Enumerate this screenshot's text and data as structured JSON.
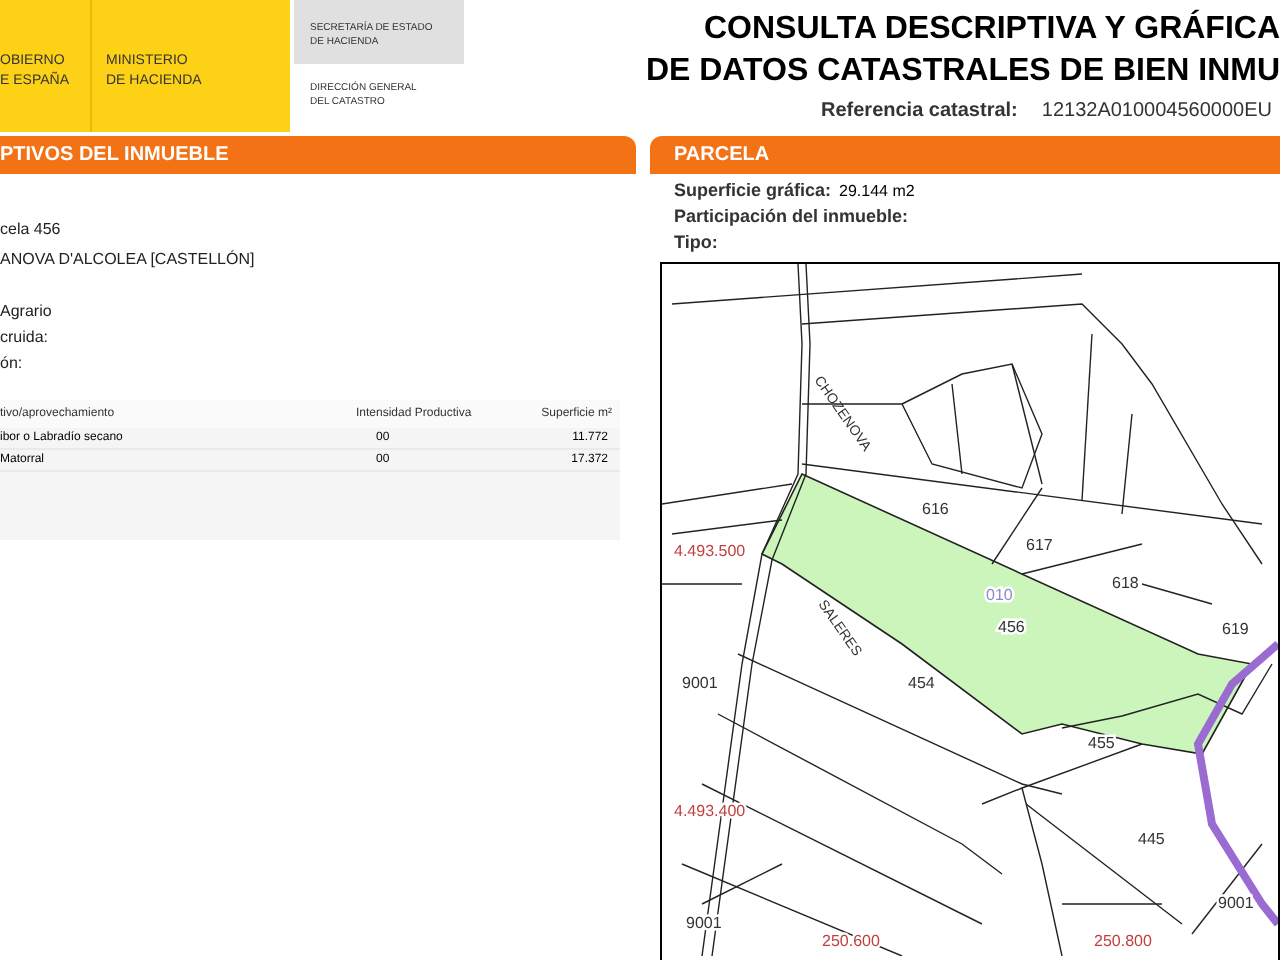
{
  "header": {
    "logo_left": [
      "OBIERNO",
      "E ESPAÑA"
    ],
    "logo_right": [
      "MINISTERIO",
      "DE HACIENDA"
    ],
    "secretaria": [
      "SECRETARÍA DE ESTADO",
      "DE HACIENDA"
    ],
    "direccion": [
      "DIRECCIÓN GENERAL",
      "DEL CATASTRO"
    ],
    "title": [
      "CONSULTA DESCRIPTIVA Y GRÁFICA",
      "DE DATOS CATASTRALES DE BIEN INMU"
    ],
    "reference_label": "Referencia catastral:",
    "reference_value": "12132A010004560000EU"
  },
  "left_panel": {
    "title": "PTIVOS DEL INMUEBLE",
    "lines": [
      "cela 456",
      "ANOVA D'ALCOLEA [CASTELLÓN]"
    ],
    "fields": [
      "Agrario",
      "cruida:",
      "ón:"
    ],
    "table": {
      "columns": [
        "tivo/aprovechamiento",
        "Intensidad Productiva",
        "Superficie m²"
      ],
      "rows": [
        [
          "ibor o Labradío secano",
          "00",
          "11.772"
        ],
        [
          "Matorral",
          "00",
          "17.372"
        ]
      ]
    }
  },
  "right_panel": {
    "title": "PARCELA",
    "fields": [
      {
        "label": "Superficie gráfica:",
        "value": "29.144 m2"
      },
      {
        "label": "Participación del inmueble:"
      },
      {
        "label": "Tipo:"
      }
    ],
    "map": {
      "labels": [
        {
          "kind": "parcel",
          "text": "616"
        },
        {
          "kind": "parcel",
          "text": "617"
        },
        {
          "kind": "parcel",
          "text": "618"
        },
        {
          "kind": "parcel",
          "text": "619"
        },
        {
          "kind": "parcel",
          "text": "456"
        },
        {
          "kind": "parcel",
          "text": "454"
        },
        {
          "kind": "parcel",
          "text": "455"
        },
        {
          "kind": "parcel",
          "text": "445"
        },
        {
          "kind": "parcel",
          "text": "9001"
        },
        {
          "kind": "parcel",
          "text": "9001"
        },
        {
          "kind": "parcel",
          "text": "9001"
        },
        {
          "kind": "special",
          "text": "010"
        },
        {
          "kind": "coord",
          "text": "4.493.500"
        },
        {
          "kind": "coord",
          "text": "4.493.400"
        },
        {
          "kind": "coord",
          "text": "250.600"
        },
        {
          "kind": "coord",
          "text": "250.800"
        }
      ],
      "streets": [
        "CHOZENOVA",
        "SALERES"
      ]
    }
  }
}
